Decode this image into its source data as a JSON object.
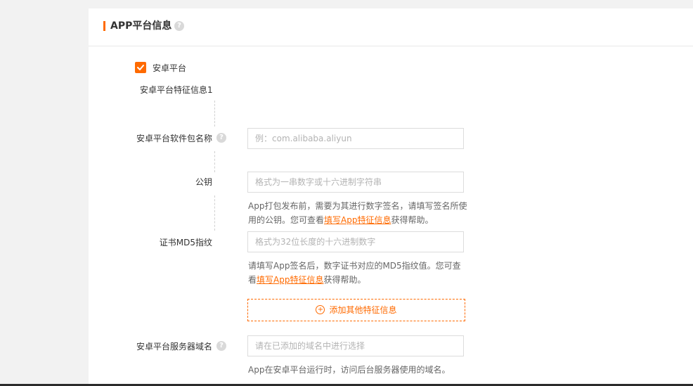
{
  "section": {
    "title": "APP平台信息",
    "help_glyph": "?"
  },
  "android": {
    "checkbox_label": "安卓平台",
    "checked": true,
    "group_title": "安卓平台特征信息1",
    "package": {
      "label": "安卓平台软件包名称",
      "placeholder": "例：com.alibaba.aliyun",
      "value": ""
    },
    "public_key": {
      "label": "公钥",
      "placeholder": "格式为一串数字或十六进制字符串",
      "value": "",
      "hint_before": "App打包发布前，需要为其进行数字签名，请填写签名所使用的公钥。您可查看",
      "hint_link": "填写App特征信息",
      "hint_after": "获得帮助。"
    },
    "md5": {
      "label": "证书MD5指纹",
      "placeholder": "格式为32位长度的十六进制数字",
      "value": "",
      "hint_before": "请填写App签名后，数字证书对应的MD5指纹值。您可查看",
      "hint_link": "填写App特征信息",
      "hint_after": "获得帮助。"
    },
    "add_button_label": "添加其他特征信息",
    "add_icon": "+",
    "server_domain": {
      "label": "安卓平台服务器域名",
      "placeholder": "请在已添加的域名中进行选择",
      "value": "",
      "hint": "App在安卓平台运行时，访问后台服务器使用的域名。"
    }
  },
  "colors": {
    "accent": "#ff6a00",
    "page_bg": "#f2f2f2",
    "panel_bg": "#ffffff"
  }
}
